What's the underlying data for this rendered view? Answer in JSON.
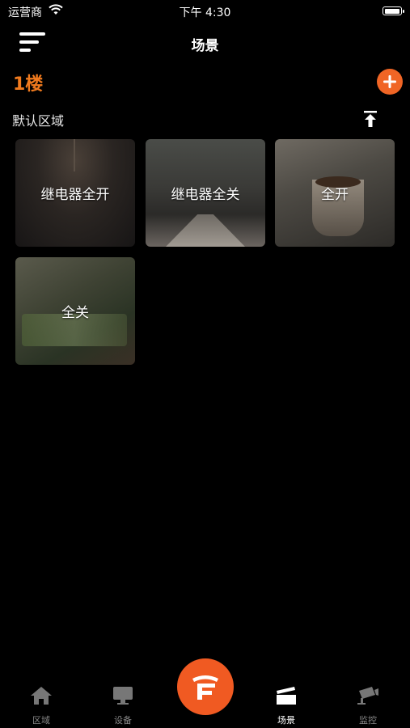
{
  "status_bar": {
    "carrier": "运营商",
    "time": "下午 4:30",
    "battery_level": 1.0
  },
  "nav": {
    "title": "场景"
  },
  "floor": {
    "name": "1楼"
  },
  "area": {
    "name": "默认区域"
  },
  "scenes": [
    {
      "name": "继电器全开",
      "image": "light-bulb-photo"
    },
    {
      "name": "继电器全关",
      "image": "misty-road-photo"
    },
    {
      "name": "全开",
      "image": "coffee-book-photo"
    },
    {
      "name": "全关",
      "image": "people-table-photo"
    }
  ],
  "tabs": [
    {
      "label": "区域",
      "icon": "home-icon",
      "active": false
    },
    {
      "label": "设备",
      "icon": "monitor-icon",
      "active": false
    },
    {
      "label": "场景",
      "icon": "clapperboard-icon",
      "active": true
    },
    {
      "label": "监控",
      "icon": "camera-icon",
      "active": false
    }
  ],
  "colors": {
    "accent": "#f07a1e",
    "fab": "#f05a22",
    "inactive_tab": "#888888"
  }
}
